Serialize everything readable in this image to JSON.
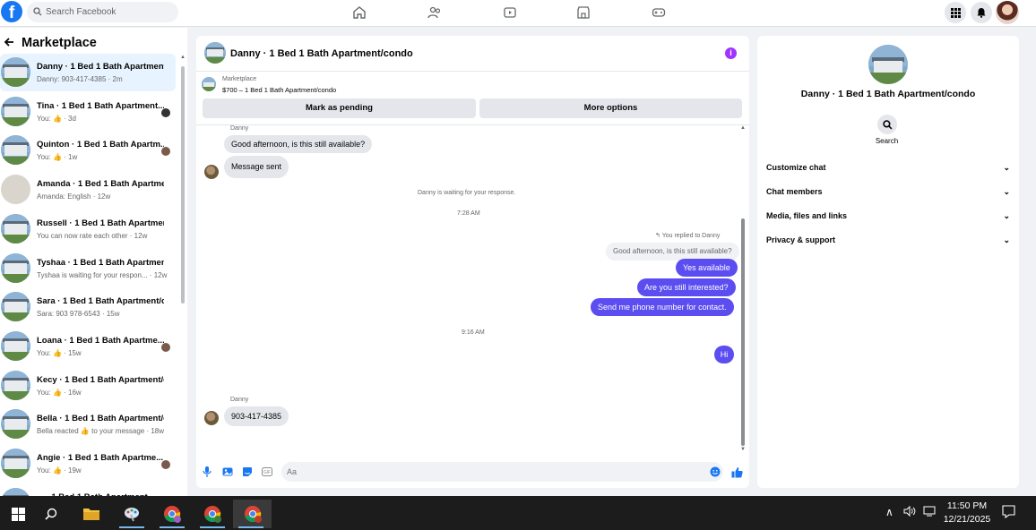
{
  "topbar": {
    "logo": "f",
    "search_placeholder": "Search Facebook",
    "nav_icons": [
      "home-icon",
      "friends-icon",
      "video-icon",
      "marketplace-icon",
      "gaming-icon"
    ],
    "right_icons": [
      "menu-grid-icon",
      "bell-icon",
      "profile-avatar"
    ]
  },
  "sidebar": {
    "title": "Marketplace",
    "conversations": [
      {
        "name": "Danny · 1 Bed 1 Bath Apartment...",
        "sub": "Danny: 903-417-4385 · 2m",
        "active": true
      },
      {
        "name": "Tina · 1 Bed 1 Bath Apartment...",
        "sub": "You: 👍 · 3d"
      },
      {
        "name": "Quinton · 1 Bed 1 Bath Apartm...",
        "sub": "You: 👍 · 1w"
      },
      {
        "name": "Amanda · 1 Bed 1 Bath Apartme...",
        "sub": "Amanda: English · 12w"
      },
      {
        "name": "Russell · 1 Bed 1 Bath Apartment...",
        "sub": "You can now rate each other · 12w"
      },
      {
        "name": "Tyshaa · 1 Bed 1 Bath Apartment...",
        "sub": "Tyshaa is waiting for your respon... · 12w"
      },
      {
        "name": "Sara · 1 Bed 1 Bath Apartment/c...",
        "sub": "Sara: 903 978-6543 · 15w"
      },
      {
        "name": "Loana · 1 Bed 1 Bath Apartme...",
        "sub": "You: 👍 · 15w"
      },
      {
        "name": "Kecy · 1 Bed 1 Bath Apartment/c...",
        "sub": "You: 👍 · 16w"
      },
      {
        "name": "Bella · 1 Bed 1 Bath Apartment/c...",
        "sub": "Bella reacted 👍 to your message · 18w"
      },
      {
        "name": "Angie · 1 Bed 1 Bath Apartme...",
        "sub": "You: 👍 · 19w"
      },
      {
        "name": "... · 1 Bed 1 Bath Apartment...",
        "sub": ""
      }
    ]
  },
  "chat": {
    "title": "Danny · 1 Bed 1 Bath Apartment/condo",
    "info_icon": "i",
    "listing_label": "Marketplace",
    "listing_price": "$700 – 1 Bed 1 Bath Apartment/condo",
    "btn_pending": "Mark as pending",
    "btn_more": "More options",
    "sender_1": "Danny",
    "msg_1": "Good afternoon, is this still available?",
    "msg_2": "Message sent",
    "waiting": "Danny is waiting for your response.",
    "time_1": "7:28 AM",
    "replied_to": "You replied to Danny",
    "reply_context": "Good afternoon, is this still available?",
    "out_1": "Yes available",
    "out_2": "Are you still interested?",
    "out_3": "Send me phone number for contact.",
    "time_2": "9:16 AM",
    "out_4": "Hi",
    "sender_2": "Danny",
    "msg_3": "903-417-4385",
    "input_placeholder": "Aa"
  },
  "details": {
    "title": "Danny · 1 Bed 1 Bath Apartment/condo",
    "search_label": "Search",
    "sections": [
      "Customize chat",
      "Chat members",
      "Media, files and links",
      "Privacy & support"
    ]
  },
  "taskbar": {
    "time": "11:50 PM",
    "date": "12/21/2025"
  },
  "colors": {
    "brand": "#1877f2",
    "outgoing_bubble": "#5b4df0",
    "info_purple": "#a033ff"
  }
}
